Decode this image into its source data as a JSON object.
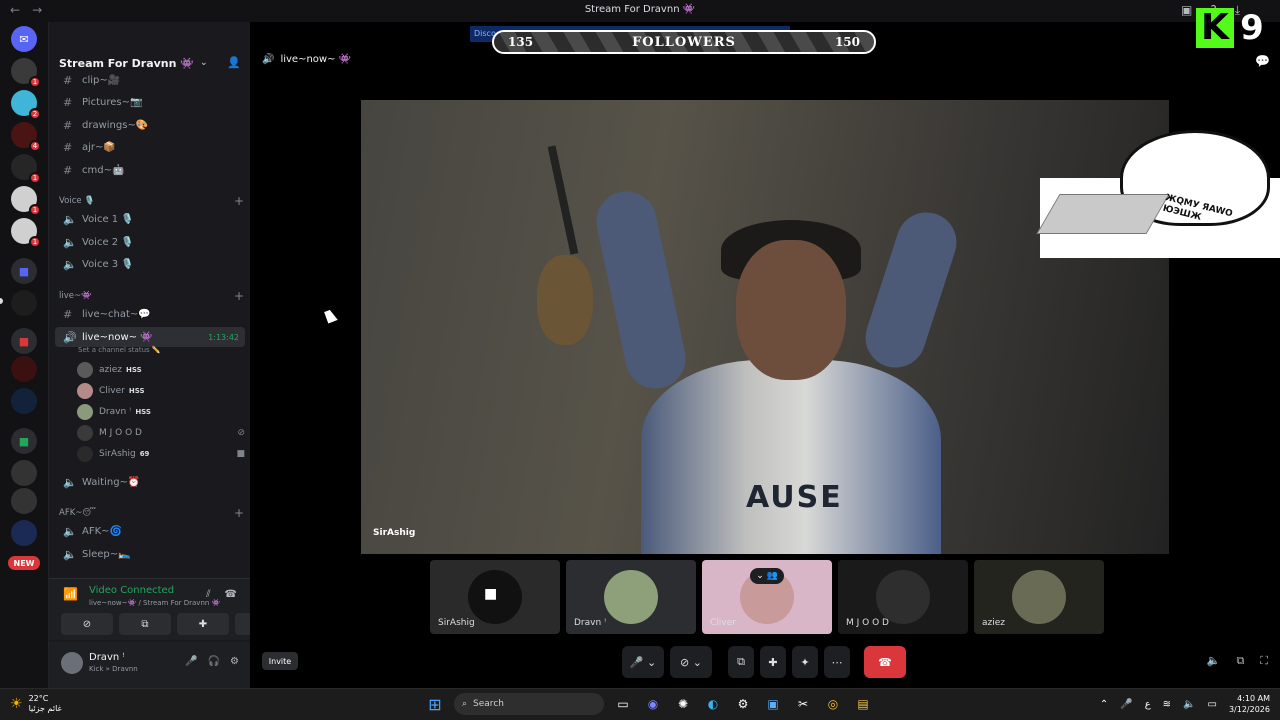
{
  "window": {
    "title": "Stream For Dravnn 👾"
  },
  "server": {
    "name": "Stream For Dravnn 👾"
  },
  "channels": {
    "text_top": [
      {
        "name": "clip~🎥"
      },
      {
        "name": "Pictures~📷"
      },
      {
        "name": "drawings~🎨"
      },
      {
        "name": "ajr~📦"
      },
      {
        "name": "cmd~🤖"
      }
    ],
    "voice_category": "Voice 🎙️",
    "voice": [
      {
        "name": "Voice 1 🎙️"
      },
      {
        "name": "Voice 2 🎙️"
      },
      {
        "name": "Voice 3 🎙️"
      }
    ],
    "live_category": "live~👾",
    "live_chat": "live~chat~💬",
    "live_now": "live~now~ 👾",
    "live_timer": "1:13:42",
    "channel_status": "Set a channel status ✏️",
    "members": [
      {
        "name": "aziez",
        "tag": "HSS"
      },
      {
        "name": "Cliver",
        "tag": "HSS"
      },
      {
        "name": "Dravn ꜝ",
        "tag": "HSS"
      },
      {
        "name": "M J O O D",
        "tag": ""
      },
      {
        "name": "SirAshig",
        "tag": "69"
      }
    ],
    "waiting": "Waiting~⏰",
    "afk_category": "AFK~😴",
    "afk": [
      {
        "name": "AFK~🌀"
      },
      {
        "name": "Sleep~🛌"
      }
    ]
  },
  "server_rail": {
    "new_label": "NEW"
  },
  "voice_panel": {
    "title": "Video Connected",
    "subtitle": "live~now~👾 / Stream For Dravnn 👾"
  },
  "user_panel": {
    "name": "Dravn ꜝ",
    "status": "Kick » Dravnn"
  },
  "stage": {
    "channel_title": "live~now~ 👾",
    "speaker": "SirAshig",
    "print_text": "AUSE",
    "invite_label": "Invite",
    "tiles": [
      {
        "name": "SirAshig"
      },
      {
        "name": "Dravn ꜝ"
      },
      {
        "name": "Cliver"
      },
      {
        "name": "M J O O D"
      },
      {
        "name": "aziez"
      }
    ]
  },
  "overlay": {
    "strip_text": "Disco",
    "followers_low": "135",
    "followers_label": "FOLLOWERS",
    "followers_high": "150",
    "kick_letter": "K",
    "kick_count": "9",
    "bongo_keys": "ЖQМУ ЯAWO ЮЭШЖ"
  },
  "taskbar": {
    "temp": "22°C",
    "weather_desc": "غائم جزئيا",
    "search": "Search",
    "lang": "ع",
    "time": "4:10 AM",
    "date": "3/12/2026"
  },
  "colors": {
    "accent_green": "#23a55a",
    "hangup_red": "#da373c",
    "kick_green": "#53fc18",
    "blurple": "#5865f2"
  }
}
